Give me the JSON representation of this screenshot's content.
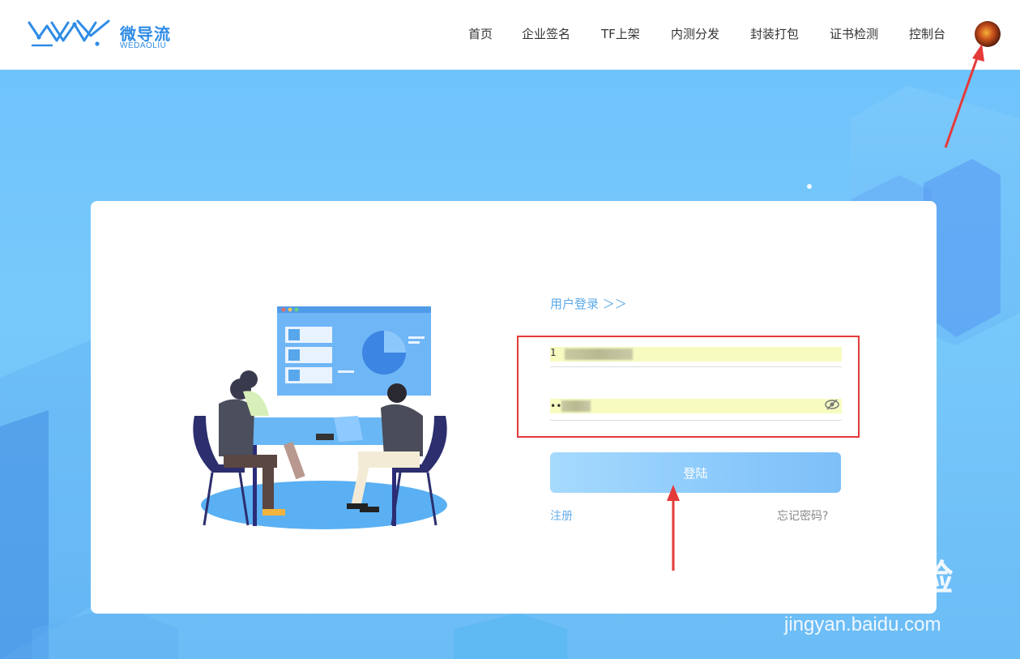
{
  "header": {
    "logo_cn": "微导流",
    "logo_en": "WEDAOLIU",
    "nav": [
      {
        "label": "首页"
      },
      {
        "label": "企业签名"
      },
      {
        "label": "TF上架"
      },
      {
        "label": "内测分发"
      },
      {
        "label": "封装打包"
      },
      {
        "label": "证书检测"
      },
      {
        "label": "控制台"
      }
    ]
  },
  "login": {
    "title": "用户登录 ＞＞",
    "username_value": "1",
    "password_value": "•••",
    "submit_label": "登陆",
    "register_label": "注册",
    "forgot_label": "忘记密码?"
  },
  "watermark": {
    "main": "Baidu经验",
    "sub": "jingyan.baidu.com"
  },
  "colors": {
    "accent": "#2f8ce6",
    "background": "#72c4fb",
    "highlight_box": "#e53a3a",
    "autofill": "#f7fbc0"
  }
}
